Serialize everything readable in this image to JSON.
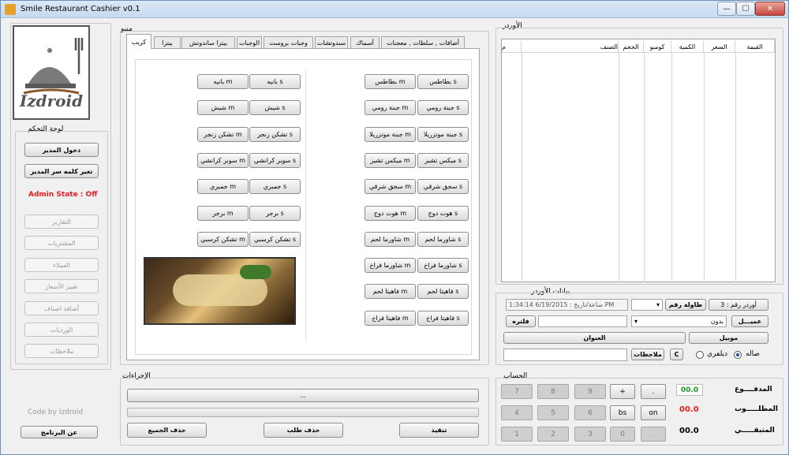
{
  "window": {
    "title": "Smile Restaurant Cashier v0.1",
    "min": "—",
    "max": "☐",
    "close": "✕"
  },
  "logo": {
    "text": "Izdroid"
  },
  "control": {
    "title": "لوحة التحكم",
    "login": "دخول المدير",
    "change_pw": "تغير كلمه سر المدير",
    "admin_state": "Admin State : Off",
    "reports": "التقارير",
    "purchases": "المشتريات",
    "customers": "العملاء",
    "price_change": "تغيير الأسعار",
    "add_item": "أضافة اصناف",
    "shifts": "الورديات",
    "notes": "ملاحظات"
  },
  "footer": {
    "credit": "Code by Izdroid",
    "about": "عن البرنامج"
  },
  "menu": {
    "title": "منيو",
    "tabs": [
      "كريب",
      "بيتزا",
      "بيتزا ساندوتش",
      "الوجبات",
      "وجبات بروست",
      "سندوتشات",
      "أسماك",
      "أضافات , سلطات , معجنات"
    ],
    "right": [
      [
        "بطاطس s",
        "بطاطس m"
      ],
      [
        "جبنة رومي s",
        "جبنة رومي m"
      ],
      [
        "جبنة موتزريلا s",
        "جبنة موتزريلا m"
      ],
      [
        "ميكس تشيز s",
        "ميكس تشيز m"
      ],
      [
        "سجق شرقي s",
        "سجق شرقي m"
      ],
      [
        "هوت دوج s",
        "هوت دوج m"
      ],
      [
        "شاورما لحم s",
        "شاورما لحم m"
      ],
      [
        "شاورما فراخ s",
        "شاورما فراخ m"
      ],
      [
        "فاهيتا لحم s",
        "فاهيتا لحم m"
      ],
      [
        "فاهيتا فراخ s",
        "فاهيتا فراخ m"
      ]
    ],
    "left": [
      [
        "بانيه s",
        "بانيه m"
      ],
      [
        "شيش s",
        "شيش m"
      ],
      [
        "تشكن زنجر s",
        "تشكن زنجر m"
      ],
      [
        "سوبر كرانشي s",
        "سوبر كرانشي m"
      ],
      [
        "جمبري s",
        "جمبري m"
      ],
      [
        "برجر s",
        "برجر m"
      ],
      [
        "تشكن كرسبي s",
        "تشكن كرسبي m"
      ]
    ]
  },
  "actions": {
    "title": "الإجراءات",
    "bar_text": "...",
    "execute": "تنفيذ",
    "delete_order": "حذف طلب",
    "delete_all": "حذف الجميع"
  },
  "order": {
    "title": "الأوردر",
    "columns": [
      "م",
      "الصنف",
      "الحجم",
      "كومبو",
      "الكمية",
      "السعر",
      "القيمة"
    ]
  },
  "order_data": {
    "title": "بيانات الأوردر",
    "order_no": "أوردر رقم : 3",
    "table_no": "طاولة رقم",
    "datetime": "ساعة/تاريخ : 6/19/2015 1:34:14 PM",
    "customer_btn": "عميـــل",
    "customer_select": "بدون",
    "filter": "فلتره",
    "mobile": "موبيل",
    "address": "العنوان",
    "c_btn": "C",
    "notes_btn": "ملاحظات",
    "hall": "صاله",
    "delivery": "ديلفري"
  },
  "account": {
    "title": "الحساب",
    "paid_label": "المدفــــوع",
    "paid": "00.0",
    "required_label": "المطلـــــوب",
    "required": "00.0",
    "remaining_label": "المتبقـــــي",
    "remaining": "00.0",
    "keys": [
      "7",
      "8",
      "9",
      "+",
      ".",
      "4",
      "5",
      "6",
      "bs",
      "on",
      "1",
      "2",
      "3",
      "0",
      "."
    ]
  },
  "colors": {
    "admin_state": "#e02020",
    "paid": "#1a9a1a",
    "required": "#e02020",
    "remaining": "#000000"
  }
}
